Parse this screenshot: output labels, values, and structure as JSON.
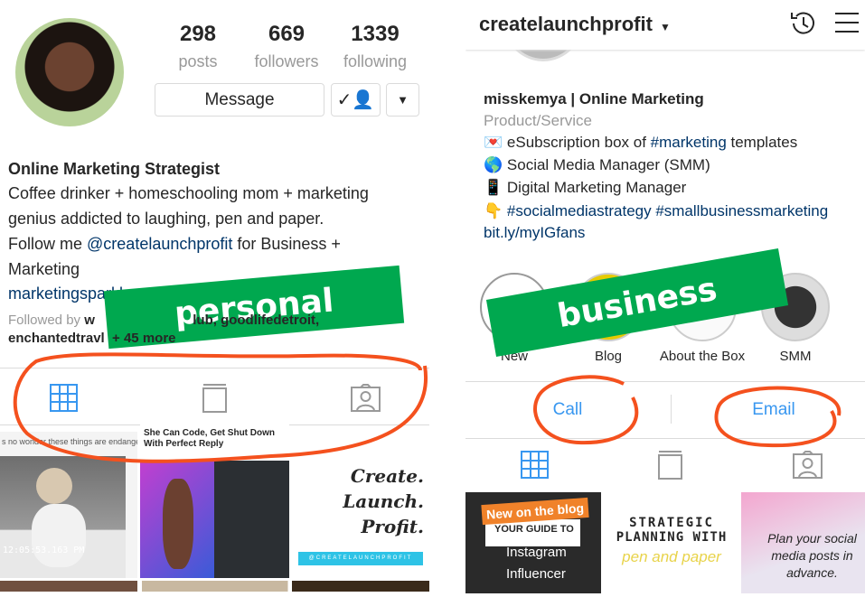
{
  "personal": {
    "stats": [
      {
        "value": "298",
        "label": "posts"
      },
      {
        "value": "669",
        "label": "followers"
      },
      {
        "value": "1339",
        "label": "following"
      }
    ],
    "message_label": "Message",
    "bio_title": "Online Marketing Strategist",
    "bio_lines": [
      "Coffee drinker + homeschooling mom + marketing",
      "genius addicted to laughing, pen and paper."
    ],
    "follow_prefix": "Follow me ",
    "follow_handle": "@createlaunchprofit",
    "follow_suffix": " for Business +",
    "follow_line2": "Marketing",
    "website": "marketingsparkl",
    "followed_by_prefix": "Followed by ",
    "followed_by_names": "w                          lub, goodlifedetroit,",
    "followed_by_line2": "enchantedtravl  + 45 more",
    "posts": [
      {
        "caption": "s no wonder these things are endangered.",
        "overlay": "12:05:53.163 PM"
      },
      {
        "caption": "She Can Code, Get Shut Down With Perfect Reply"
      },
      {
        "lines": [
          "Create.",
          "Launch.",
          "Profit."
        ],
        "tag": "@CREATELAUNCHPROFIT"
      }
    ],
    "annotation": "personal"
  },
  "business": {
    "username": "createlaunchprofit",
    "name": "misskemya | Online Marketing",
    "category": "Product/Service",
    "bio": [
      {
        "emoji": "💌",
        "text": "eSubscription box of ",
        "tag": "#marketing",
        "after": " templates"
      },
      {
        "emoji": "🌎",
        "text": "Social Media Manager (SMM)"
      },
      {
        "emoji": "📱",
        "text": "Digital Marketing Manager"
      },
      {
        "emoji": "👇",
        "tag": "#socialmediastrategy #smallbusinessmarketing"
      }
    ],
    "website": "bit.ly/myIGfans",
    "highlights": [
      "New",
      "Blog",
      "About the Box",
      "SMM"
    ],
    "call_label": "Call",
    "email_label": "Email",
    "posts": [
      {
        "badge": "New on the blog",
        "l1": "YOUR GUIDE TO",
        "l2": "Instagram",
        "l3": "Influencer"
      },
      {
        "l1": "STRATEGIC",
        "l2": "PLANNING WITH",
        "l3": "pen and paper"
      },
      {
        "l1": "Plan your social",
        "l2": "media posts in",
        "l3": "advance."
      }
    ],
    "annotation": "business"
  },
  "colors": {
    "accent": "#3897f0",
    "link": "#003569",
    "banner": "#00a84f",
    "annotation": "#f4511e"
  }
}
